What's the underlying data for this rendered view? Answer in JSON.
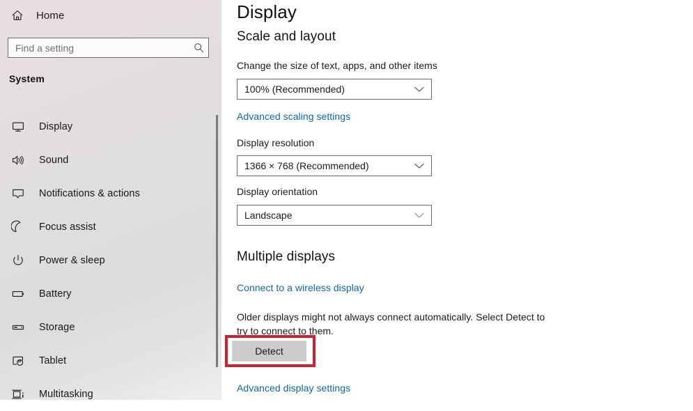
{
  "sidebar": {
    "home": {
      "label": "Home",
      "icon": "home-icon"
    },
    "search": {
      "placeholder": "Find a setting",
      "value": "",
      "icon": "search-icon"
    },
    "group_title": "System",
    "items": [
      {
        "label": "Display",
        "icon": "monitor-icon"
      },
      {
        "label": "Sound",
        "icon": "speaker-icon"
      },
      {
        "label": "Notifications & actions",
        "icon": "notification-bubble-icon"
      },
      {
        "label": "Focus assist",
        "icon": "moon-icon"
      },
      {
        "label": "Power & sleep",
        "icon": "power-icon"
      },
      {
        "label": "Battery",
        "icon": "battery-icon"
      },
      {
        "label": "Storage",
        "icon": "storage-icon"
      },
      {
        "label": "Tablet",
        "icon": "tablet-touch-icon"
      },
      {
        "label": "Multitasking",
        "icon": "multitasking-icon"
      }
    ]
  },
  "main": {
    "page_title": "Display",
    "scale_section": {
      "heading": "Scale and layout",
      "scale_label": "Change the size of text, apps, and other items",
      "scale_value": "100% (Recommended)",
      "advanced_scaling_link": "Advanced scaling settings",
      "resolution_label": "Display resolution",
      "resolution_value": "1366 × 768 (Recommended)",
      "orientation_label": "Display orientation",
      "orientation_value": "Landscape"
    },
    "multiple_displays_section": {
      "heading": "Multiple displays",
      "wireless_link": "Connect to a wireless display",
      "helper_text": "Older displays might not always connect automatically. Select Detect to try to connect to them.",
      "detect_button": "Detect",
      "advanced_display_link": "Advanced display settings"
    }
  },
  "colors": {
    "link": "#0a67b3",
    "annotation_highlight": "#d4202a",
    "button_fill": "#cccccc",
    "combo_border": "#6b6b6b"
  }
}
